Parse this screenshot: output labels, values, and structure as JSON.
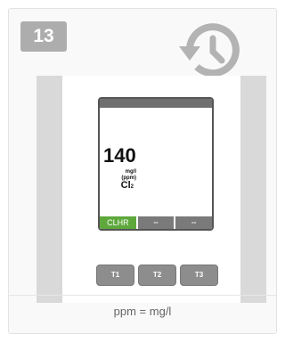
{
  "step": {
    "number": "13"
  },
  "icons": {
    "history": "history-icon"
  },
  "device": {
    "reading": {
      "value": "140",
      "unit_line1": "mg/l",
      "unit_line2": "(ppm)",
      "param_main": "Cl",
      "param_sub": "2"
    },
    "softkeys": [
      {
        "label": "CLHR",
        "active": true
      },
      {
        "label": "--",
        "active": false
      },
      {
        "label": "--",
        "active": false
      }
    ],
    "buttons": [
      {
        "label": "T1"
      },
      {
        "label": "T2"
      },
      {
        "label": "T3"
      }
    ]
  },
  "caption": "ppm = mg/l",
  "colors": {
    "softkey_active": "#5ea83c",
    "softkey_inactive": "#7a7a7a",
    "button": "#8d8d8d",
    "badge": "#adadad"
  }
}
